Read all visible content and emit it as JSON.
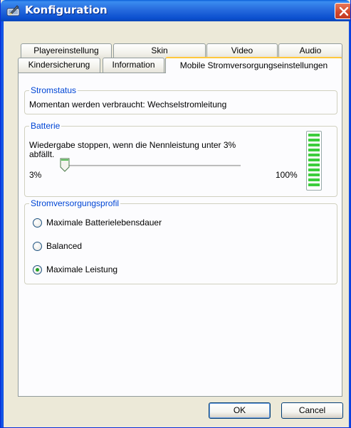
{
  "window": {
    "title": "Konfiguration",
    "title_icon": "pen-tablet-icon",
    "close_icon": "close-icon"
  },
  "tabs": {
    "row_back": [
      {
        "label": "Playereinstellung"
      },
      {
        "label": "Skin"
      },
      {
        "label": "Video"
      },
      {
        "label": "Audio"
      }
    ],
    "row_front": [
      {
        "label": "Kindersicherung"
      },
      {
        "label": "Information"
      },
      {
        "label": "Mobile Stromversorgungseinstellungen",
        "active": true
      }
    ]
  },
  "power_status": {
    "legend": "Stromstatus",
    "text": "Momentan werden verbraucht: Wechselstromleitung"
  },
  "battery": {
    "legend": "Batterie",
    "description_line1": "Wiedergabe stoppen, wenn die Nennleistung unter 3%",
    "description_line2": "abfällt.",
    "slider_min_label": "3%",
    "slider_max_label": "100%",
    "slider_value_fraction": 0.0,
    "level_fraction": 1.0,
    "level_color": "#3ccd3c"
  },
  "power_profile": {
    "legend": "Stromversorgungsprofil",
    "options": [
      {
        "label": "Maximale Batterielebensdauer",
        "checked": false
      },
      {
        "label": "Balanced",
        "checked": false
      },
      {
        "label": "Maximale Leistung",
        "checked": true
      }
    ]
  },
  "buttons": {
    "ok": "OK",
    "cancel": "Cancel"
  },
  "colors": {
    "titlebar": "#0b4fcf",
    "legend_text": "#0046d5",
    "active_tab_highlight": "#ffc83c",
    "close_button": "#d0452a"
  }
}
